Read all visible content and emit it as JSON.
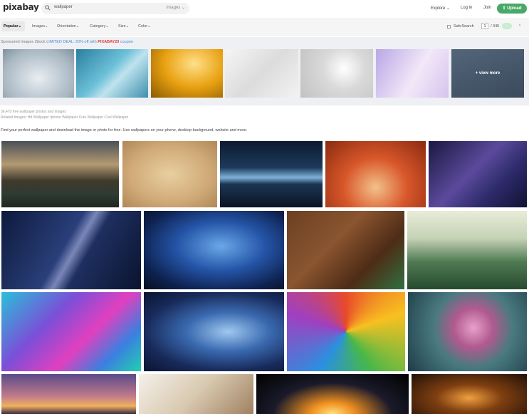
{
  "header": {
    "logo": "pixabay",
    "search_value": "wallpaper",
    "search_scope": "Images",
    "nav": [
      "Explore",
      "Log in",
      "Join"
    ],
    "upload_label": "Upload"
  },
  "filters": {
    "items": [
      "Popular",
      "Images",
      "Orientation",
      "Category",
      "Size",
      "Color"
    ],
    "safesearch": "SafeSearch",
    "page": "1",
    "total_pages": "/ 345"
  },
  "sponsored": {
    "label": "Sponsored Images iStock",
    "deal": "LIMITED DEAL: 20% off with",
    "code": "PIXABAY20",
    "suffix": "coupon",
    "view_more": "+ view more"
  },
  "results": {
    "count": "36,470 free wallpaper photos and images",
    "related": "Related Images:  Hd Wallpaper  Iphone Wallpaper  Cute Wallpaper  Cool Wallpaper",
    "intro": "Find your perfect wallpaper and download the image or photo for free. Use wallpapers on your phone, desktop background, website and more."
  },
  "colors": {
    "accent": "#48a868"
  }
}
